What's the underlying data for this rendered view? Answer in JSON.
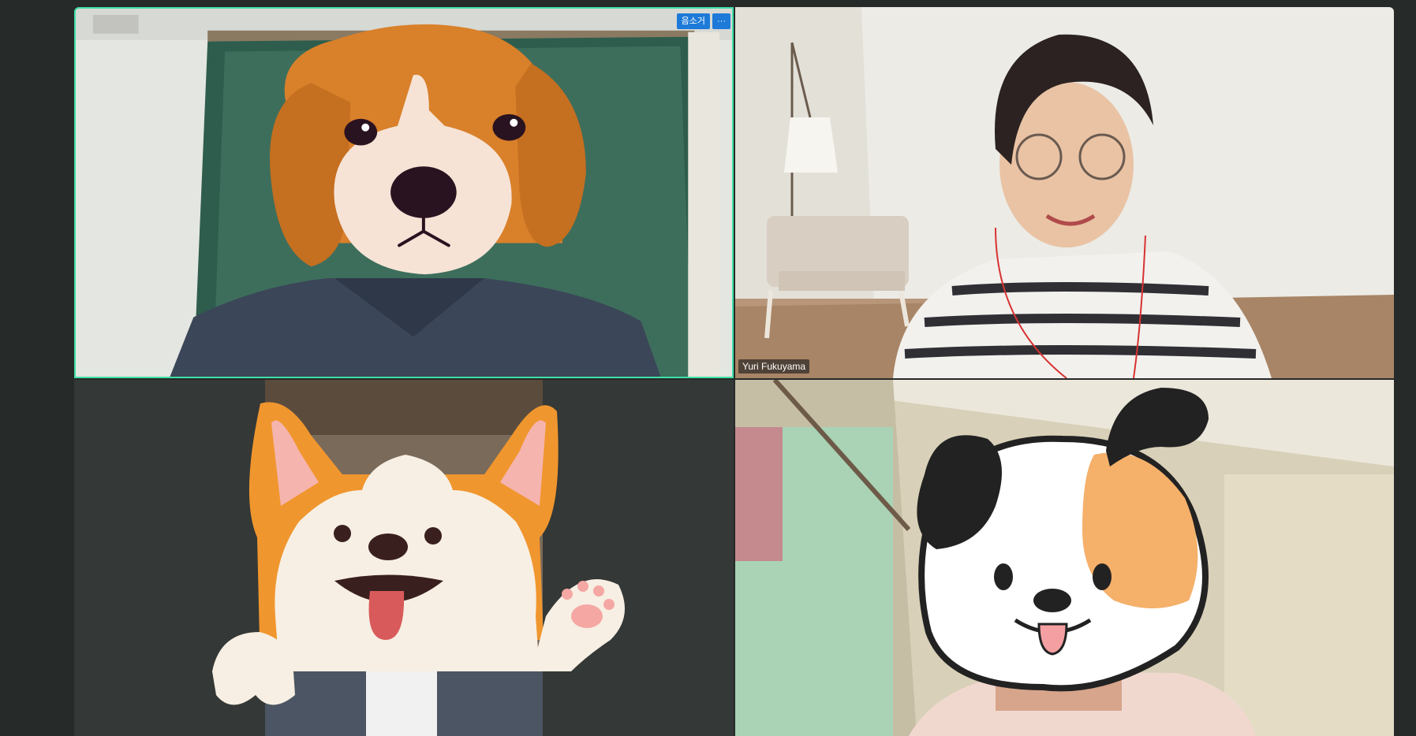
{
  "tiles": [
    {
      "id": "t1",
      "avatar": "beagle-dog",
      "active": true,
      "controls": {
        "mute_label": "음소거",
        "more_label": "···"
      }
    },
    {
      "id": "t2",
      "participant_name": "Yuri Fukuyama"
    },
    {
      "id": "t3",
      "avatar": "corgi-dog"
    },
    {
      "id": "t4",
      "avatar": "spotted-puppy"
    }
  ],
  "colors": {
    "active_border": "#3fe0a6",
    "accent_button": "#1d7ad8",
    "background": "#262a29"
  }
}
